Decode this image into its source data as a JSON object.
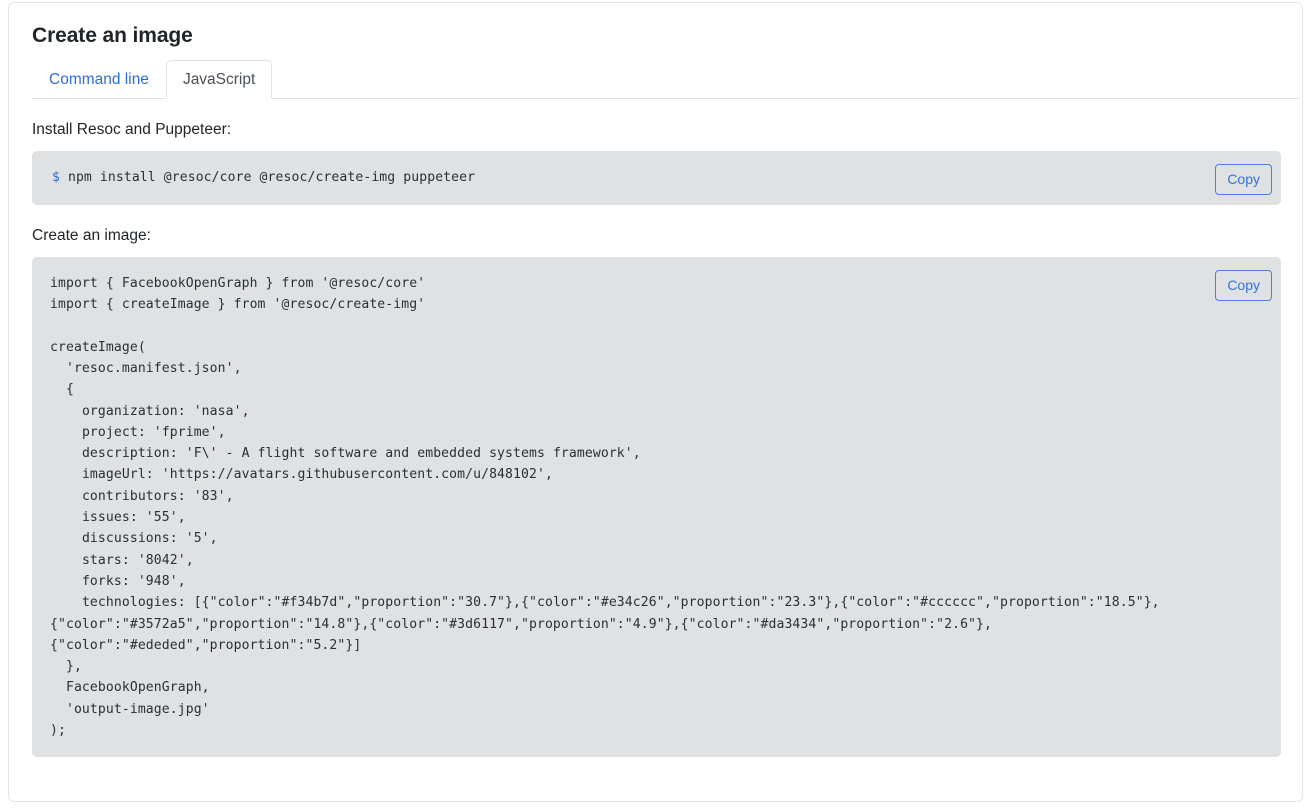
{
  "page": {
    "title": "Create an image"
  },
  "tabs": [
    {
      "label": "Command line",
      "active": false
    },
    {
      "label": "JavaScript",
      "active": true
    }
  ],
  "sections": [
    {
      "label": "Install Resoc and Puppeteer:",
      "kind": "shell",
      "prompt": "$",
      "code": " npm install @resoc/core @resoc/create-img puppeteer",
      "copy_label": "Copy"
    },
    {
      "label": "Create an image:",
      "kind": "javascript",
      "code": "import { FacebookOpenGraph } from '@resoc/core'\nimport { createImage } from '@resoc/create-img'\n\ncreateImage(\n  'resoc.manifest.json',\n  {\n    organization: 'nasa',\n    project: 'fprime',\n    description: 'F\\' - A flight software and embedded systems framework',\n    imageUrl: 'https://avatars.githubusercontent.com/u/848102',\n    contributors: '83',\n    issues: '55',\n    discussions: '5',\n    stars: '8042',\n    forks: '948',\n    technologies: [{\"color\":\"#f34b7d\",\"proportion\":\"30.7\"},{\"color\":\"#e34c26\",\"proportion\":\"23.3\"},{\"color\":\"#cccccc\",\"proportion\":\"18.5\"},{\"color\":\"#3572a5\",\"proportion\":\"14.8\"},{\"color\":\"#3d6117\",\"proportion\":\"4.9\"},{\"color\":\"#da3434\",\"proportion\":\"2.6\"},{\"color\":\"#ededed\",\"proportion\":\"5.2\"}]\n  },\n  FacebookOpenGraph,\n  'output-image.jpg'\n);",
      "copy_label": "Copy"
    }
  ],
  "colors": {
    "link": "#2f6fd0",
    "code_bg": "#e0e1e2",
    "card_border": "#e3e5e7",
    "text": "#212529"
  }
}
